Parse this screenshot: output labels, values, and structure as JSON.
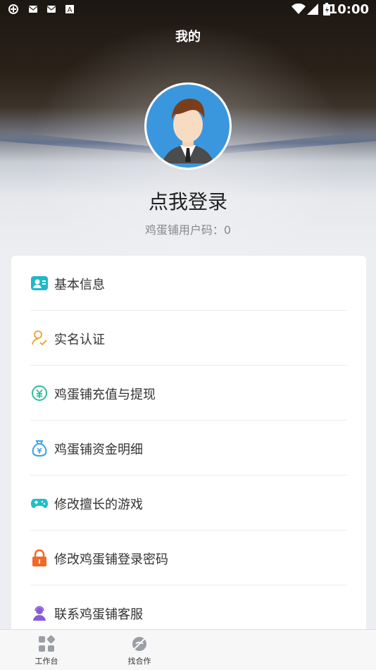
{
  "status": {
    "time": "10:00"
  },
  "header": {
    "title": "我的"
  },
  "profile": {
    "login_text": "点我登录",
    "user_code": "鸡蛋铺用户码：0"
  },
  "menu": [
    {
      "label": "基本信息",
      "icon": "profile-card-icon",
      "color": "#21b7c7"
    },
    {
      "label": "实名认证",
      "icon": "user-verify-icon",
      "color": "#f0a93a"
    },
    {
      "label": "鸡蛋铺充值与提现",
      "icon": "yuan-coin-icon",
      "color": "#2bbf9b"
    },
    {
      "label": "鸡蛋铺资金明细",
      "icon": "money-bag-icon",
      "color": "#3aa3e0"
    },
    {
      "label": "修改擅长的游戏",
      "icon": "gamepad-icon",
      "color": "#1fbfc8"
    },
    {
      "label": "修改鸡蛋铺登录密码",
      "icon": "lock-icon",
      "color": "#f06a2a"
    },
    {
      "label": "联系鸡蛋铺客服",
      "icon": "customer-service-icon",
      "color": "#8a5bd6"
    }
  ],
  "tabs": [
    {
      "label": "工作台",
      "icon": "grid-icon"
    },
    {
      "label": "找合作",
      "icon": "cooperation-icon"
    }
  ]
}
